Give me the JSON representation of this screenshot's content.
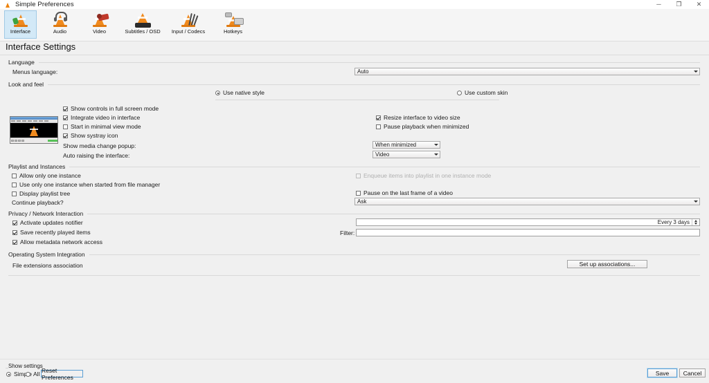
{
  "window": {
    "title": "Simple Preferences",
    "app_icon": "vlc-cone-icon",
    "minimize": "─",
    "restore": "❐",
    "close": "✕"
  },
  "toolbar": {
    "items": [
      {
        "label": "Interface",
        "icon": "vlc-cone-icon",
        "selected": true
      },
      {
        "label": "Audio",
        "icon": "headphones-cone-icon",
        "selected": false
      },
      {
        "label": "Video",
        "icon": "film-cone-icon",
        "selected": false
      },
      {
        "label": "Subtitles / OSD",
        "icon": "subtitles-cone-icon",
        "selected": false
      },
      {
        "label": "Input / Codecs",
        "icon": "input-codecs-cone-icon",
        "selected": false
      },
      {
        "label": "Hotkeys",
        "icon": "hotkeys-cone-icon",
        "selected": false
      }
    ]
  },
  "page": {
    "title": "Interface Settings"
  },
  "sections": {
    "language": {
      "title": "Language",
      "menus_language_label": "Menus language:",
      "menus_language_value": "Auto"
    },
    "look_and_feel": {
      "title": "Look and feel",
      "style_native": "Use native style",
      "style_custom_skin": "Use custom skin",
      "style_selected": "native",
      "checks_left": [
        {
          "label": "Show controls in full screen mode",
          "checked": true
        },
        {
          "label": "Integrate video in interface",
          "checked": true
        },
        {
          "label": "Start in minimal view mode",
          "checked": false
        },
        {
          "label": "Show systray icon",
          "checked": true
        }
      ],
      "checks_right": [
        {
          "label": "Resize interface to video size",
          "checked": true
        },
        {
          "label": "Pause playback when minimized",
          "checked": false
        }
      ],
      "media_change_popup_label": "Show media change popup:",
      "media_change_popup_value": "When minimized",
      "auto_raise_label": "Auto raising the interface:",
      "auto_raise_value": "Video",
      "preview": "vlc-window-preview"
    },
    "playlist": {
      "title": "Playlist and Instances",
      "checks_left": [
        {
          "label": "Allow only one instance",
          "checked": false
        },
        {
          "label": "Use only one instance when started from file manager",
          "checked": false
        },
        {
          "label": "Display playlist tree",
          "checked": false
        }
      ],
      "enqueue": {
        "label": "Enqueue items into playlist in one instance mode",
        "checked": false,
        "disabled": true
      },
      "pause_last_frame": {
        "label": "Pause on the last frame of a video",
        "checked": false
      },
      "continue_playback_label": "Continue playback?",
      "continue_playback_value": "Ask"
    },
    "privacy": {
      "title": "Privacy / Network Interaction",
      "checks": [
        {
          "label": "Activate updates notifier",
          "checked": true
        },
        {
          "label": "Save recently played items",
          "checked": true
        },
        {
          "label": "Allow metadata network access",
          "checked": true
        }
      ],
      "update_interval_value": "Every 3 days",
      "filter_label": "Filter:",
      "filter_value": "",
      "filter_placeholder": ""
    },
    "os_integration": {
      "title": "Operating System Integration",
      "file_ext_label": "File extensions association",
      "setup_button": "Set up associations..."
    }
  },
  "footer": {
    "show_settings_label": "Show settings",
    "simple_label": "Simple",
    "all_label": "All",
    "show_settings_selected": "Simple",
    "reset_button": "Reset Preferences",
    "save_button": "Save",
    "cancel_button": "Cancel"
  }
}
